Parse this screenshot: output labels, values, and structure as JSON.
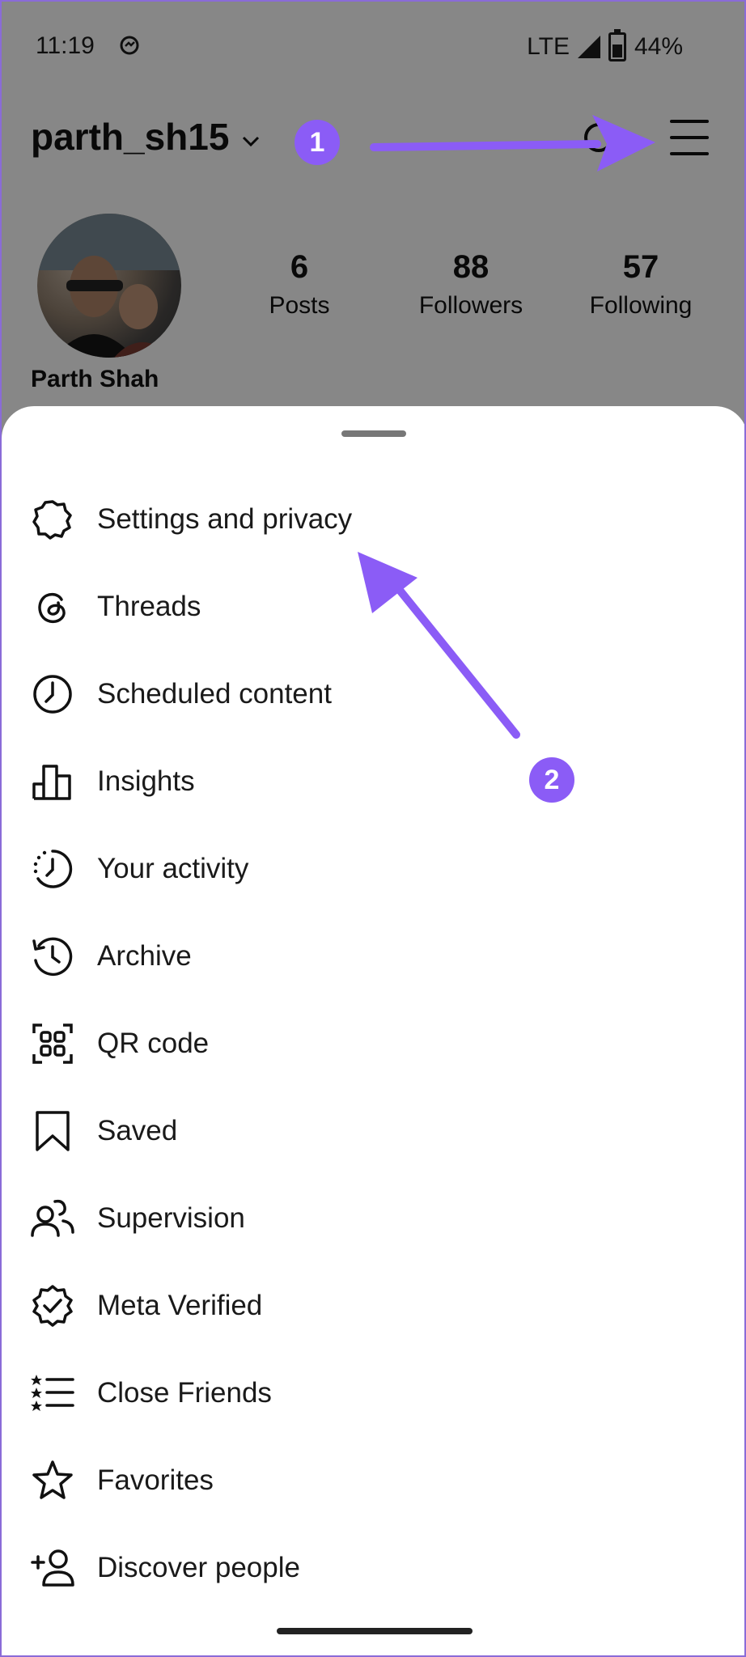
{
  "status_bar": {
    "time": "11:19",
    "network": "LTE",
    "battery": "44%"
  },
  "profile": {
    "username": "parth_sh15",
    "full_name": "Parth Shah",
    "stats": [
      {
        "value": "6",
        "label": "Posts"
      },
      {
        "value": "88",
        "label": "Followers"
      },
      {
        "value": "57",
        "label": "Following"
      }
    ]
  },
  "annotations": {
    "badge1": "1",
    "badge2": "2",
    "accent": "#8b5cf6"
  },
  "menu": {
    "items": [
      {
        "label": "Settings and privacy",
        "icon": "settings-icon"
      },
      {
        "label": "Threads",
        "icon": "threads-icon"
      },
      {
        "label": "Scheduled content",
        "icon": "clock-icon"
      },
      {
        "label": "Insights",
        "icon": "bar-chart-icon"
      },
      {
        "label": "Your activity",
        "icon": "activity-icon"
      },
      {
        "label": "Archive",
        "icon": "archive-icon"
      },
      {
        "label": "QR code",
        "icon": "qr-code-icon"
      },
      {
        "label": "Saved",
        "icon": "bookmark-icon"
      },
      {
        "label": "Supervision",
        "icon": "supervision-icon"
      },
      {
        "label": "Meta Verified",
        "icon": "verified-badge-icon"
      },
      {
        "label": "Close Friends",
        "icon": "close-friends-icon"
      },
      {
        "label": "Favorites",
        "icon": "star-icon"
      },
      {
        "label": "Discover people",
        "icon": "add-person-icon"
      }
    ]
  }
}
